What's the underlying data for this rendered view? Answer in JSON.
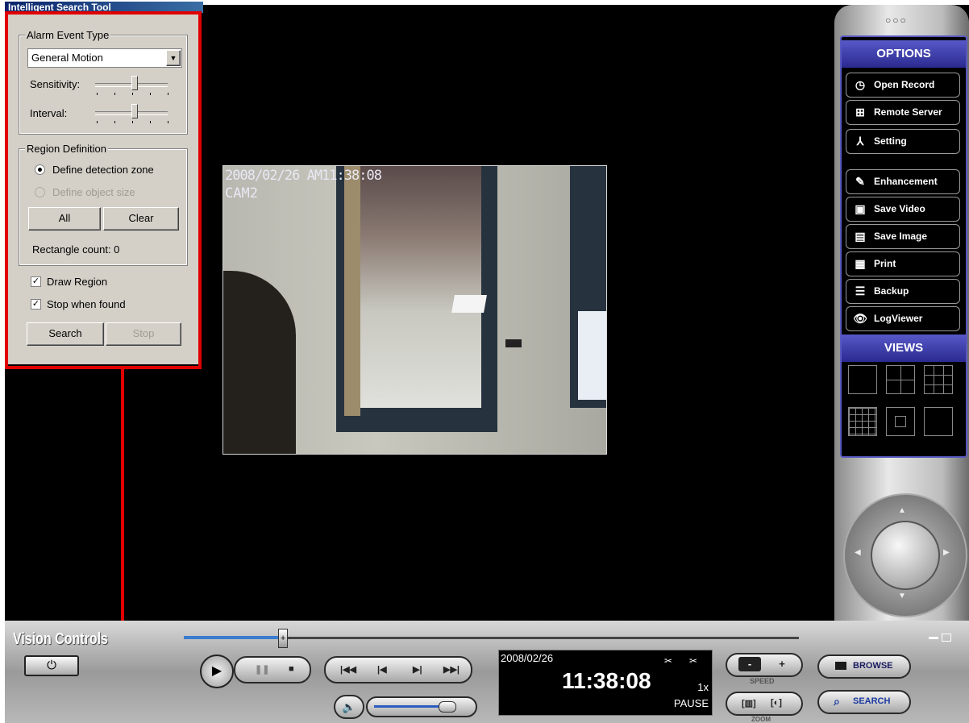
{
  "search_tool": {
    "title": "Intelligent Search Tool",
    "alarm_group": "Alarm Event Type",
    "event_type_value": "General Motion",
    "sensitivity_label": "Sensitivity:",
    "interval_label": "Interval:",
    "sensitivity_level": 0.55,
    "interval_level": 0.55,
    "region_group": "Region Definition",
    "define_zone_label": "Define detection zone",
    "define_size_label": "Define object size",
    "all_label": "All",
    "clear_label": "Clear",
    "rect_count_label": "Rectangle count: 0",
    "draw_region_label": "Draw Region",
    "stop_found_label": "Stop when found",
    "search_label": "Search",
    "stop_label": "Stop"
  },
  "video": {
    "osd_datetime": "2008/02/26 AM11:38:08",
    "osd_camera": "CAM2"
  },
  "options": {
    "header": "OPTIONS",
    "items": [
      {
        "label": "Open Record",
        "icon": "clock-icon",
        "glyph": "◷"
      },
      {
        "label": "Remote Server",
        "icon": "remote-server-icon",
        "glyph": "⊞"
      },
      {
        "label": "Setting",
        "icon": "setting-icon",
        "glyph": "⅄"
      },
      {
        "label": "Enhancement",
        "icon": "pencil-icon",
        "glyph": "✎"
      },
      {
        "label": "Save Video",
        "icon": "save-video-icon",
        "glyph": "▣"
      },
      {
        "label": "Save  Image",
        "icon": "save-image-icon",
        "glyph": "▤"
      },
      {
        "label": "Print",
        "icon": "printer-icon",
        "glyph": "▦"
      },
      {
        "label": "Backup",
        "icon": "backup-icon",
        "glyph": "☰"
      },
      {
        "label": "LogViewer",
        "icon": "log-viewer-icon",
        "glyph": "👁"
      }
    ],
    "views_header": "VIEWS"
  },
  "bottom": {
    "title": "Vision Controls",
    "date": "2008/02/26",
    "time": "11:38:08",
    "speed_value": "1x",
    "status": "PAUSE",
    "speed_label": "SPEED",
    "zoom_label": "ZOOM",
    "browse_label": "BROWSE",
    "search_label": "SEARCH",
    "speed_minus": "-",
    "speed_plus": "+",
    "playback_progress": 0.16,
    "volume_level": 0.85
  }
}
